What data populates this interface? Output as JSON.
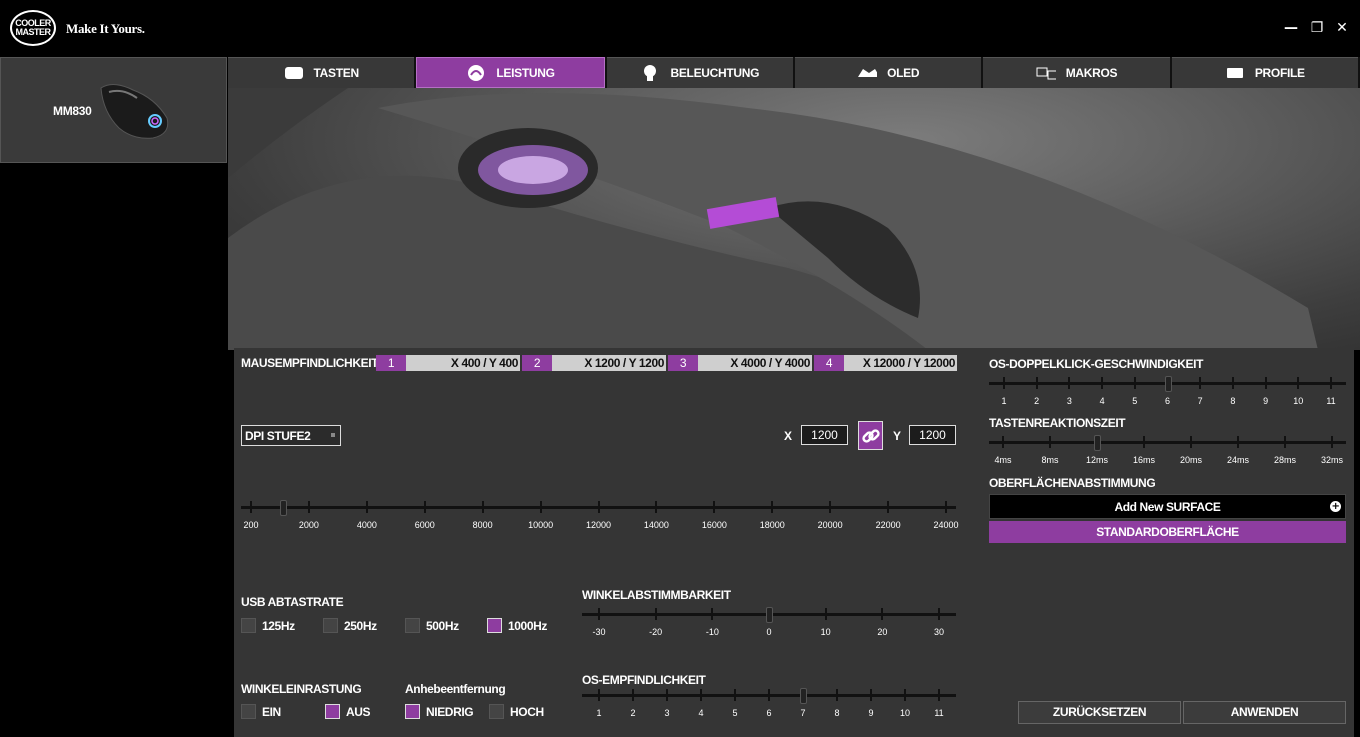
{
  "header": {
    "logo_text": "COOLER MASTER",
    "tagline": "Make It Yours."
  },
  "window": {
    "minimize": "—",
    "restore": "❐",
    "close": "✕"
  },
  "device": {
    "name": "MM830"
  },
  "tabs": [
    {
      "label": "TASTEN",
      "icon": "keyboard-icon",
      "active": false
    },
    {
      "label": "LEISTUNG",
      "icon": "performance-icon",
      "active": true
    },
    {
      "label": "BELEUCHTUNG",
      "icon": "lighting-icon",
      "active": false
    },
    {
      "label": "OLED",
      "icon": "oled-icon",
      "active": false
    },
    {
      "label": "MAKROS",
      "icon": "macro-icon",
      "active": false
    },
    {
      "label": "PROFILE",
      "icon": "profile-icon",
      "active": false
    }
  ],
  "sensitivity": {
    "title": "MAUSEMPFINDLICHKEIT",
    "stages": [
      {
        "num": "1",
        "value": "X 400 / Y 400"
      },
      {
        "num": "2",
        "value": "X 1200 / Y 1200"
      },
      {
        "num": "3",
        "value": "X 4000 / Y 4000"
      },
      {
        "num": "4",
        "value": "X 12000 / Y 12000"
      }
    ],
    "selected_stage": "DPI STUFE2",
    "x_label": "X",
    "x_value": "1200",
    "y_label": "Y",
    "y_value": "1200",
    "dpi_ticks": [
      "200",
      "2000",
      "4000",
      "6000",
      "8000",
      "10000",
      "12000",
      "14000",
      "16000",
      "18000",
      "20000",
      "22000",
      "24000"
    ],
    "dpi_value": 1200
  },
  "usb": {
    "title": "USB ABTASTRATE",
    "options": [
      {
        "label": "125Hz",
        "checked": false
      },
      {
        "label": "250Hz",
        "checked": false
      },
      {
        "label": "500Hz",
        "checked": false
      },
      {
        "label": "1000Hz",
        "checked": true
      }
    ]
  },
  "angle_snap": {
    "title": "WINKELEINRASTUNG",
    "options": [
      {
        "label": "EIN",
        "checked": false
      },
      {
        "label": "AUS",
        "checked": true
      }
    ]
  },
  "lift_off": {
    "title": "Anhebeentfernung",
    "options": [
      {
        "label": "NIEDRIG",
        "checked": true
      },
      {
        "label": "HOCH",
        "checked": false
      }
    ]
  },
  "angle_tuning": {
    "title": "WINKELABSTIMMBARKEIT",
    "ticks": [
      "-30",
      "-20",
      "-10",
      "0",
      "10",
      "20",
      "30"
    ],
    "value": 0
  },
  "os_sensitivity": {
    "title": "OS-EMPFINDLICHKEIT",
    "ticks": [
      "1",
      "2",
      "3",
      "4",
      "5",
      "6",
      "7",
      "8",
      "9",
      "10",
      "11"
    ],
    "value": 7
  },
  "os_doubleclick": {
    "title": "OS-DOPPELKLICK-GESCHWINDIGKEIT",
    "ticks": [
      "1",
      "2",
      "3",
      "4",
      "5",
      "6",
      "7",
      "8",
      "9",
      "10",
      "11"
    ],
    "value": 6
  },
  "response_time": {
    "title": "TASTENREAKTIONSZEIT",
    "ticks": [
      "4ms",
      "8ms",
      "12ms",
      "16ms",
      "20ms",
      "24ms",
      "28ms",
      "32ms"
    ],
    "value_index": 2
  },
  "surface": {
    "title": "OBERFLÄCHENABSTIMMUNG",
    "add_label": "Add New SURFACE",
    "default_label": "STANDARDOBERFLÄCHE"
  },
  "buttons": {
    "reset": "ZURÜCKSETZEN",
    "apply": "ANWENDEN"
  },
  "colors": {
    "accent": "#8e3da0",
    "panel": "#353535"
  }
}
